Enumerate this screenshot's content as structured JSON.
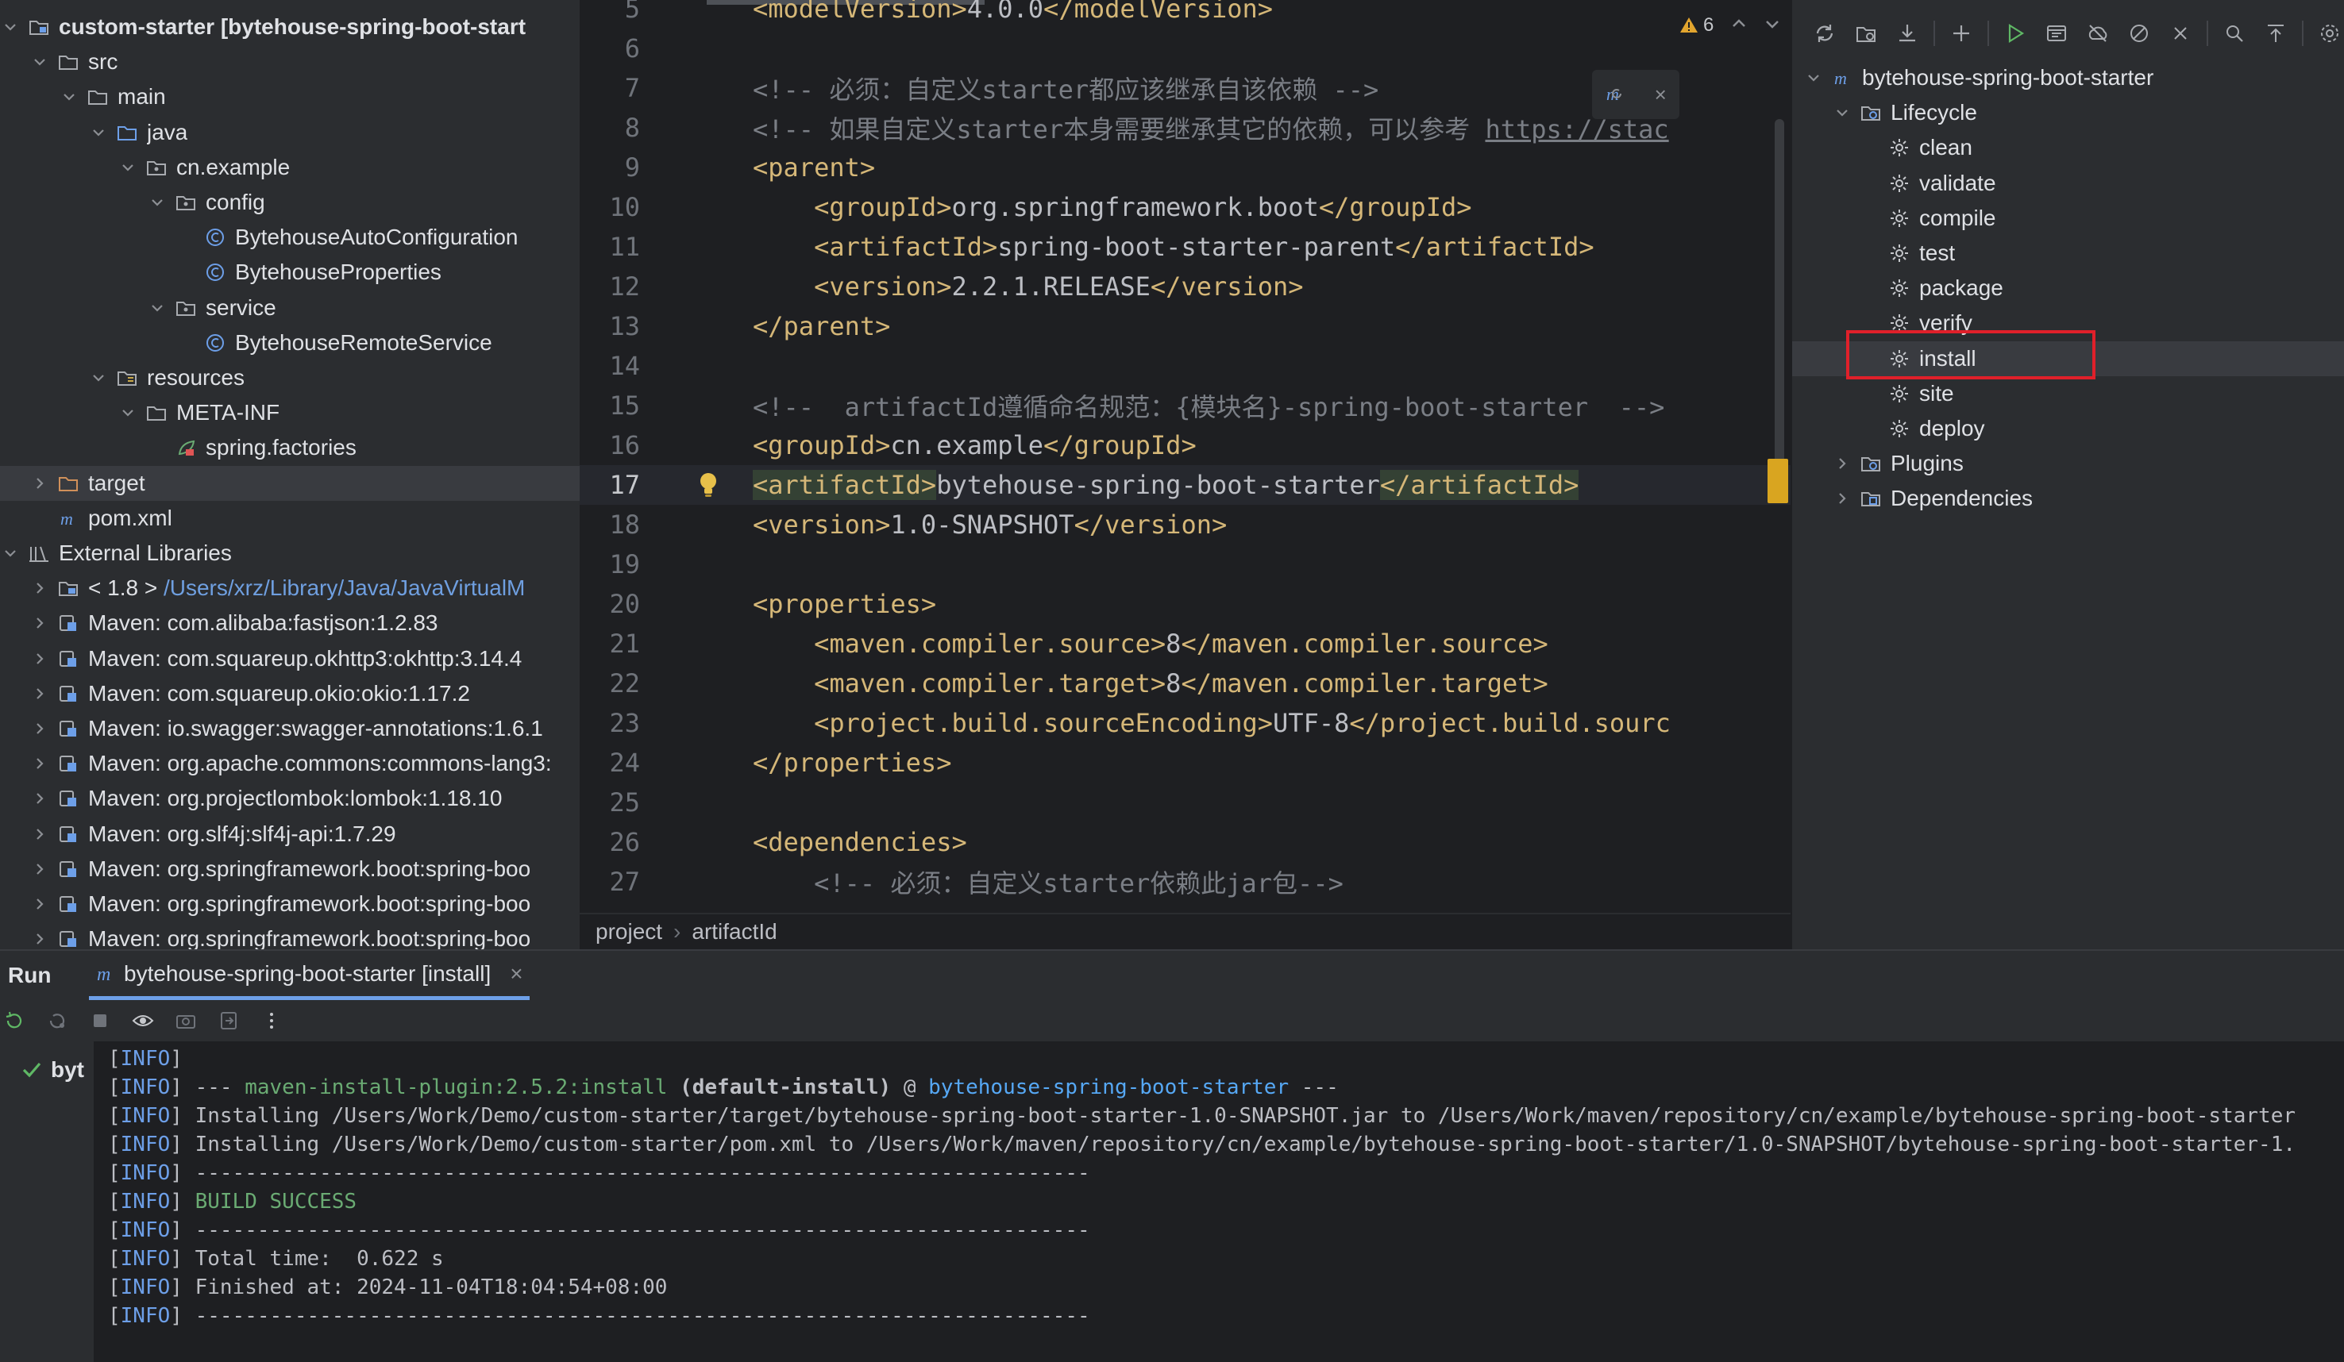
{
  "project_tree": {
    "items": [
      {
        "label": "custom-starter [bytehouse-spring-boot-start",
        "bold": true,
        "icon": "module-folder-icon",
        "arrow": "down",
        "indent": 0
      },
      {
        "label": "src",
        "icon": "folder-icon",
        "arrow": "down",
        "indent": 1
      },
      {
        "label": "main",
        "icon": "folder-icon",
        "arrow": "down",
        "indent": 2
      },
      {
        "label": "java",
        "icon": "source-folder-icon",
        "arrow": "down",
        "indent": 3
      },
      {
        "label": "cn.example",
        "icon": "package-icon",
        "arrow": "down",
        "indent": 4
      },
      {
        "label": "config",
        "icon": "package-icon",
        "arrow": "down",
        "indent": 5
      },
      {
        "label": "BytehouseAutoConfiguration",
        "icon": "class-icon",
        "arrow": "none",
        "indent": 6
      },
      {
        "label": "BytehouseProperties",
        "icon": "class-icon",
        "arrow": "none",
        "indent": 6
      },
      {
        "label": "service",
        "icon": "package-icon",
        "arrow": "down",
        "indent": 5
      },
      {
        "label": "BytehouseRemoteService",
        "icon": "class-icon",
        "arrow": "none",
        "indent": 6
      },
      {
        "label": "resources",
        "icon": "resources-folder-icon",
        "arrow": "down",
        "indent": 3
      },
      {
        "label": "META-INF",
        "icon": "folder-icon",
        "arrow": "down",
        "indent": 4
      },
      {
        "label": "spring.factories",
        "icon": "spring-file-icon",
        "arrow": "none",
        "indent": 5
      },
      {
        "label": "target",
        "icon": "excluded-folder-icon",
        "arrow": "right",
        "indent": 1,
        "selected": true
      },
      {
        "label": "pom.xml",
        "icon": "maven-file-icon",
        "arrow": "none",
        "indent": 1
      },
      {
        "label": "External Libraries",
        "icon": "libraries-icon",
        "arrow": "down",
        "indent": 0
      },
      {
        "label": "< 1.8 > ",
        "path": "/Users/xrz/Library/Java/JavaVirtualM",
        "icon": "jdk-icon",
        "arrow": "right",
        "indent": 1
      },
      {
        "label": "Maven: com.alibaba:fastjson:1.2.83",
        "icon": "library-icon",
        "arrow": "right",
        "indent": 1
      },
      {
        "label": "Maven: com.squareup.okhttp3:okhttp:3.14.4",
        "icon": "library-icon",
        "arrow": "right",
        "indent": 1
      },
      {
        "label": "Maven: com.squareup.okio:okio:1.17.2",
        "icon": "library-icon",
        "arrow": "right",
        "indent": 1
      },
      {
        "label": "Maven: io.swagger:swagger-annotations:1.6.1",
        "icon": "library-icon",
        "arrow": "right",
        "indent": 1
      },
      {
        "label": "Maven: org.apache.commons:commons-lang3:",
        "icon": "library-icon",
        "arrow": "right",
        "indent": 1
      },
      {
        "label": "Maven: org.projectlombok:lombok:1.18.10",
        "icon": "library-icon",
        "arrow": "right",
        "indent": 1
      },
      {
        "label": "Maven: org.slf4j:slf4j-api:1.7.29",
        "icon": "library-icon",
        "arrow": "right",
        "indent": 1
      },
      {
        "label": "Maven: org.springframework.boot:spring-boo",
        "icon": "library-icon",
        "arrow": "right",
        "indent": 1
      },
      {
        "label": "Maven: org.springframework.boot:spring-boo",
        "icon": "library-icon",
        "arrow": "right",
        "indent": 1
      },
      {
        "label": "Maven: org.springframework.boot:spring-boo",
        "icon": "library-icon",
        "arrow": "right",
        "indent": 1
      }
    ]
  },
  "editor": {
    "warning_count": "6",
    "current_line": 17,
    "lines": [
      {
        "num": "5",
        "parts": [
          {
            "t": "<modelVersion>",
            "c": "tag"
          },
          {
            "t": "4.0.0",
            "c": "txt"
          },
          {
            "t": "</modelVersion>",
            "c": "tag"
          }
        ]
      },
      {
        "num": "6",
        "parts": []
      },
      {
        "num": "7",
        "parts": [
          {
            "t": "<!-- 必须：自定义starter都应该继承自该依赖 -->",
            "c": "cmt"
          }
        ]
      },
      {
        "num": "8",
        "parts": [
          {
            "t": "<!-- 如果自定义starter本身需要继承其它的依赖，可以参考 ",
            "c": "cmt"
          },
          {
            "t": "https://stac",
            "c": "lnk"
          }
        ]
      },
      {
        "num": "9",
        "parts": [
          {
            "t": "<parent>",
            "c": "tag"
          }
        ]
      },
      {
        "num": "10",
        "parts": [
          {
            "t": "    <groupId>",
            "c": "tag"
          },
          {
            "t": "org.springframework.boot",
            "c": "txt"
          },
          {
            "t": "</groupId>",
            "c": "tag"
          }
        ]
      },
      {
        "num": "11",
        "parts": [
          {
            "t": "    <artifactId>",
            "c": "tag"
          },
          {
            "t": "spring-boot-starter-parent",
            "c": "txt"
          },
          {
            "t": "</artifactId>",
            "c": "tag"
          }
        ]
      },
      {
        "num": "12",
        "parts": [
          {
            "t": "    <version>",
            "c": "tag"
          },
          {
            "t": "2.2.1.RELEASE",
            "c": "txt"
          },
          {
            "t": "</version>",
            "c": "tag"
          }
        ]
      },
      {
        "num": "13",
        "parts": [
          {
            "t": "</parent>",
            "c": "tag"
          }
        ]
      },
      {
        "num": "14",
        "parts": []
      },
      {
        "num": "15",
        "parts": [
          {
            "t": "<!--  artifactId遵循命名规范：{模块名}-spring-boot-starter  -->",
            "c": "cmt"
          }
        ]
      },
      {
        "num": "16",
        "parts": [
          {
            "t": "<groupId>",
            "c": "tag"
          },
          {
            "t": "cn.example",
            "c": "txt"
          },
          {
            "t": "</groupId>",
            "c": "tag"
          }
        ]
      },
      {
        "num": "17",
        "parts": [
          {
            "t": "<artifactId>",
            "c": "tag hl"
          },
          {
            "t": "bytehouse-spring-boot-starter",
            "c": "txt"
          },
          {
            "t": "</artifactId>",
            "c": "tag hl"
          }
        ]
      },
      {
        "num": "18",
        "parts": [
          {
            "t": "<version>",
            "c": "tag"
          },
          {
            "t": "1.0-SNAPSHOT",
            "c": "txt"
          },
          {
            "t": "</version>",
            "c": "tag"
          }
        ]
      },
      {
        "num": "19",
        "parts": []
      },
      {
        "num": "20",
        "parts": [
          {
            "t": "<properties>",
            "c": "tag"
          }
        ]
      },
      {
        "num": "21",
        "parts": [
          {
            "t": "    <maven.compiler.source>",
            "c": "tag"
          },
          {
            "t": "8",
            "c": "txt"
          },
          {
            "t": "</maven.compiler.source>",
            "c": "tag"
          }
        ]
      },
      {
        "num": "22",
        "parts": [
          {
            "t": "    <maven.compiler.target>",
            "c": "tag"
          },
          {
            "t": "8",
            "c": "txt"
          },
          {
            "t": "</maven.compiler.target>",
            "c": "tag"
          }
        ]
      },
      {
        "num": "23",
        "parts": [
          {
            "t": "    <project.build.sourceEncoding>",
            "c": "tag"
          },
          {
            "t": "UTF-8",
            "c": "txt"
          },
          {
            "t": "</project.build.sourc",
            "c": "tag"
          }
        ]
      },
      {
        "num": "24",
        "parts": [
          {
            "t": "</properties>",
            "c": "tag"
          }
        ]
      },
      {
        "num": "25",
        "parts": []
      },
      {
        "num": "26",
        "parts": [
          {
            "t": "<dependencies>",
            "c": "tag"
          }
        ]
      },
      {
        "num": "27",
        "parts": [
          {
            "t": "    <!-- 必须：自定义starter依赖此jar包-->",
            "c": "cmt"
          }
        ]
      }
    ]
  },
  "breadcrumb": [
    "project",
    "artifactId"
  ],
  "maven": {
    "items": [
      {
        "label": "bytehouse-spring-boot-starter",
        "icon": "maven-project-icon",
        "arrow": "down",
        "indent": 0
      },
      {
        "label": "Lifecycle",
        "icon": "lifecycle-folder-icon",
        "arrow": "down",
        "indent": 1
      },
      {
        "label": "clean",
        "icon": "gear-icon",
        "arrow": "none",
        "indent": 2
      },
      {
        "label": "validate",
        "icon": "gear-icon",
        "arrow": "none",
        "indent": 2
      },
      {
        "label": "compile",
        "icon": "gear-icon",
        "arrow": "none",
        "indent": 2
      },
      {
        "label": "test",
        "icon": "gear-icon",
        "arrow": "none",
        "indent": 2
      },
      {
        "label": "package",
        "icon": "gear-icon",
        "arrow": "none",
        "indent": 2
      },
      {
        "label": "verify",
        "icon": "gear-icon",
        "arrow": "none",
        "indent": 2
      },
      {
        "label": "install",
        "icon": "gear-icon",
        "arrow": "none",
        "indent": 2,
        "selected": true
      },
      {
        "label": "site",
        "icon": "gear-icon",
        "arrow": "none",
        "indent": 2
      },
      {
        "label": "deploy",
        "icon": "gear-icon",
        "arrow": "none",
        "indent": 2
      },
      {
        "label": "Plugins",
        "icon": "plugins-folder-icon",
        "arrow": "right",
        "indent": 1
      },
      {
        "label": "Dependencies",
        "icon": "dependencies-folder-icon",
        "arrow": "right",
        "indent": 1
      }
    ]
  },
  "run": {
    "title": "Run",
    "tab_label": "bytehouse-spring-boot-starter [install]",
    "tree_item": "byt",
    "console": [
      [
        {
          "t": "[",
          "c": ""
        },
        {
          "t": "INFO",
          "c": "lvl"
        },
        {
          "t": "]",
          "c": ""
        }
      ],
      [
        {
          "t": "[",
          "c": ""
        },
        {
          "t": "INFO",
          "c": "lvl"
        },
        {
          "t": "] --- ",
          "c": ""
        },
        {
          "t": "maven-install-plugin:2.5.2:install",
          "c": "green"
        },
        {
          "t": " (default-install)",
          "c": "bold"
        },
        {
          "t": " @ ",
          "c": ""
        },
        {
          "t": "bytehouse-spring-boot-starter",
          "c": "blue"
        },
        {
          "t": " ---",
          "c": ""
        }
      ],
      [
        {
          "t": "[",
          "c": ""
        },
        {
          "t": "INFO",
          "c": "lvl"
        },
        {
          "t": "] Installing /Users/Work/Demo/custom-starter/target/bytehouse-spring-boot-starter-1.0-SNAPSHOT.jar to /Users/Work/maven/repository/cn/example/bytehouse-spring-boot-starter",
          "c": ""
        }
      ],
      [
        {
          "t": "[",
          "c": ""
        },
        {
          "t": "INFO",
          "c": "lvl"
        },
        {
          "t": "] Installing /Users/Work/Demo/custom-starter/pom.xml to /Users/Work/maven/repository/cn/example/bytehouse-spring-boot-starter/1.0-SNAPSHOT/bytehouse-spring-boot-starter-1.",
          "c": ""
        }
      ],
      [
        {
          "t": "[",
          "c": ""
        },
        {
          "t": "INFO",
          "c": "lvl"
        },
        {
          "t": "] ------------------------------------------------------------------------",
          "c": ""
        }
      ],
      [
        {
          "t": "[",
          "c": ""
        },
        {
          "t": "INFO",
          "c": "lvl"
        },
        {
          "t": "] ",
          "c": ""
        },
        {
          "t": "BUILD SUCCESS",
          "c": "green"
        }
      ],
      [
        {
          "t": "[",
          "c": ""
        },
        {
          "t": "INFO",
          "c": "lvl"
        },
        {
          "t": "] ------------------------------------------------------------------------",
          "c": ""
        }
      ],
      [
        {
          "t": "[",
          "c": ""
        },
        {
          "t": "INFO",
          "c": "lvl"
        },
        {
          "t": "] Total time:  0.622 s",
          "c": ""
        }
      ],
      [
        {
          "t": "[",
          "c": ""
        },
        {
          "t": "INFO",
          "c": "lvl"
        },
        {
          "t": "] Finished at: 2024-11-04T18:04:54+08:00",
          "c": ""
        }
      ],
      [
        {
          "t": "[",
          "c": ""
        },
        {
          "t": "INFO",
          "c": "lvl"
        },
        {
          "t": "] ------------------------------------------------------------------------",
          "c": ""
        }
      ]
    ]
  },
  "colors": {
    "highlight_box": "#e0202a",
    "accent": "#6d9fe8",
    "warning": "#d9a520"
  }
}
